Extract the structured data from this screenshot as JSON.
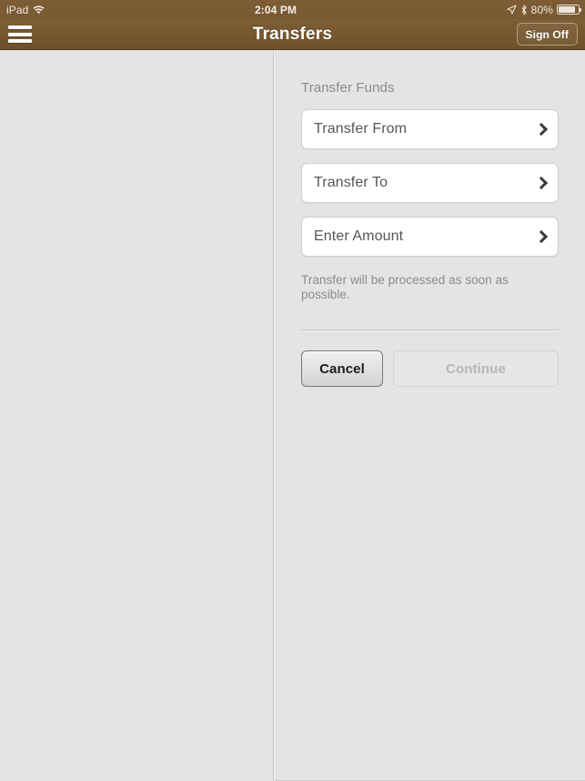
{
  "status_bar": {
    "device": "iPad",
    "wifi_icon": "wifi-icon",
    "time": "2:04 PM",
    "location_icon": "location-arrow-icon",
    "bluetooth_icon": "bluetooth-icon",
    "battery_percent": "80%",
    "battery_icon": "battery-icon"
  },
  "nav_bar": {
    "menu_icon": "hamburger-menu-icon",
    "title": "Transfers",
    "sign_off_label": "Sign Off"
  },
  "main": {
    "section_title": "Transfer Funds",
    "rows": [
      {
        "label": "Transfer From",
        "chevron_icon": "chevron-right-icon"
      },
      {
        "label": "Transfer To",
        "chevron_icon": "chevron-right-icon"
      },
      {
        "label": "Enter Amount",
        "chevron_icon": "chevron-right-icon"
      }
    ],
    "note": "Transfer will be processed as soon as possible.",
    "buttons": {
      "cancel_label": "Cancel",
      "continue_label": "Continue",
      "continue_enabled": false
    }
  },
  "colors": {
    "brand_brown": "#7a5a32",
    "nav_brown_dark": "#6d5029",
    "page_background": "#e3e3e3",
    "row_background": "#ffffff",
    "muted_text": "#8b8b90",
    "row_text": "#55555a"
  }
}
